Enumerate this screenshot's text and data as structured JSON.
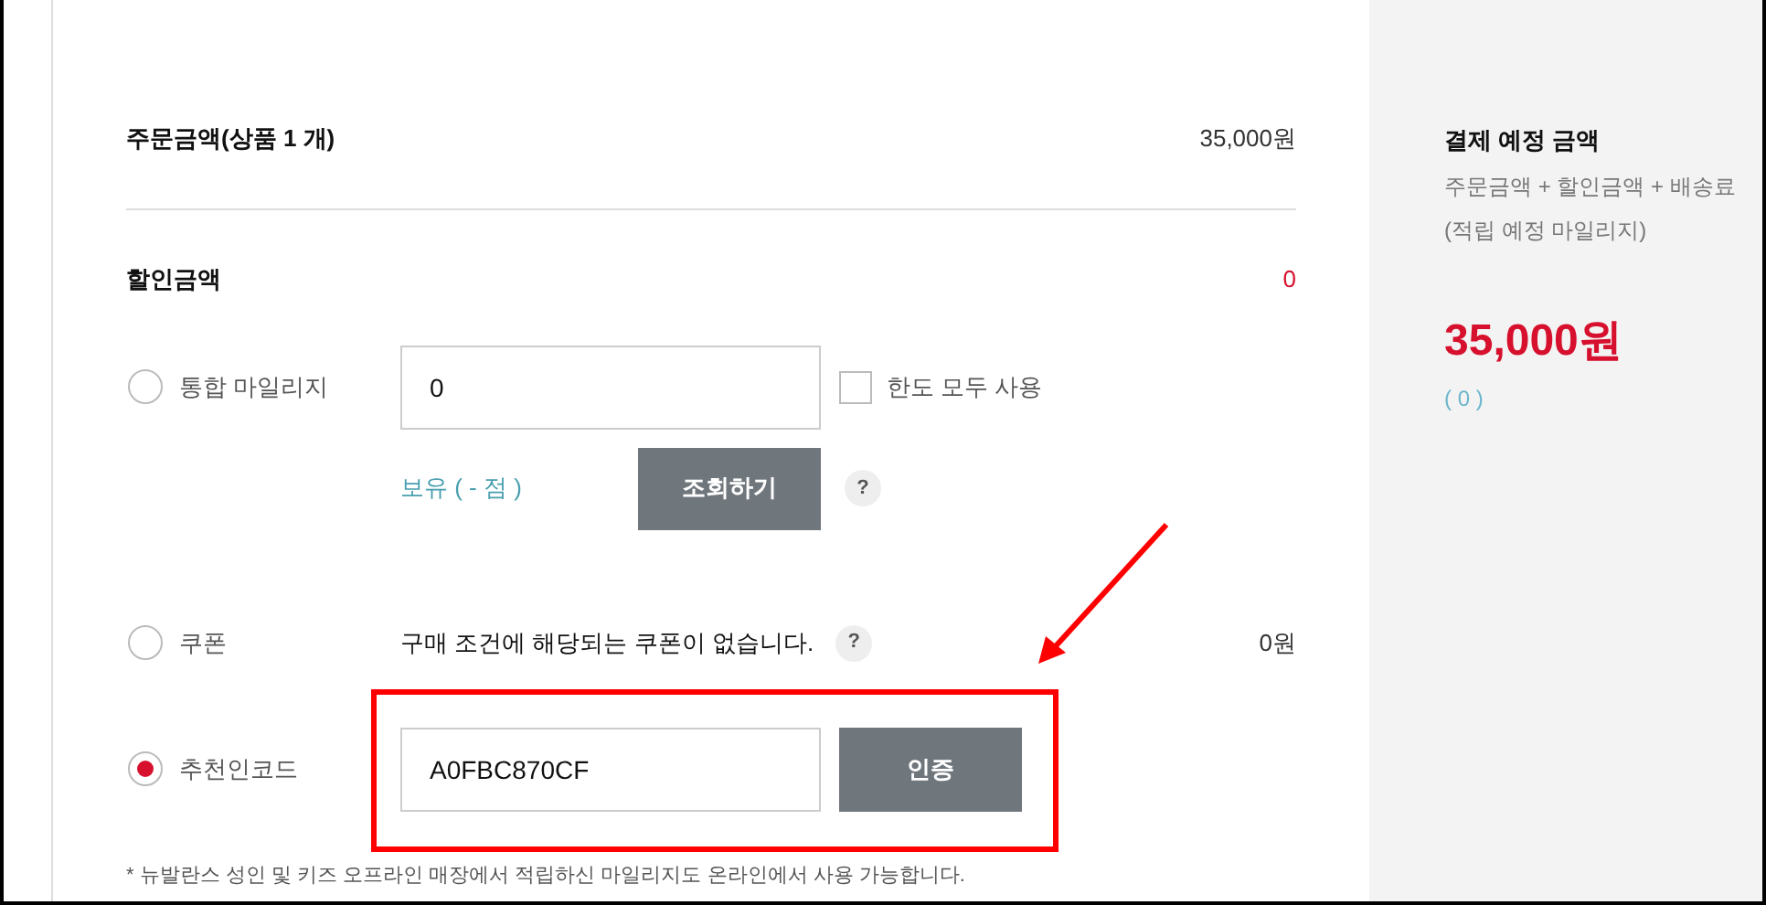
{
  "order": {
    "label": "주문금액(상품 1 개)",
    "amount": "35,000원"
  },
  "discount": {
    "label": "할인금액",
    "amount": "0"
  },
  "mileage": {
    "label": "통합 마일리지",
    "selected": false,
    "value": "0",
    "use_all": {
      "label": "한도 모두 사용",
      "checked": false
    },
    "balance": "보유 ( - 점 )",
    "lookup_button": "조회하기",
    "help": "?"
  },
  "coupon": {
    "label": "쿠폰",
    "selected": false,
    "message": "구매 조건에 해당되는 쿠폰이 없습니다.",
    "help": "?",
    "amount": "0원"
  },
  "referral": {
    "label": "추천인코드",
    "selected": true,
    "value": "A0FBC870CF",
    "button": "인증"
  },
  "note": "* 뉴발란스 성인 및 키즈 오프라인 매장에서 적립하신 마일리지도 온라인에서 사용 가능합니다.",
  "summary": {
    "title": "결제 예정 금액",
    "formula": "주문금액 + 할인금액 + 배송료",
    "sub": "(적립 예정 마일리지)",
    "total": "35,000원",
    "points": "( 0 )"
  }
}
